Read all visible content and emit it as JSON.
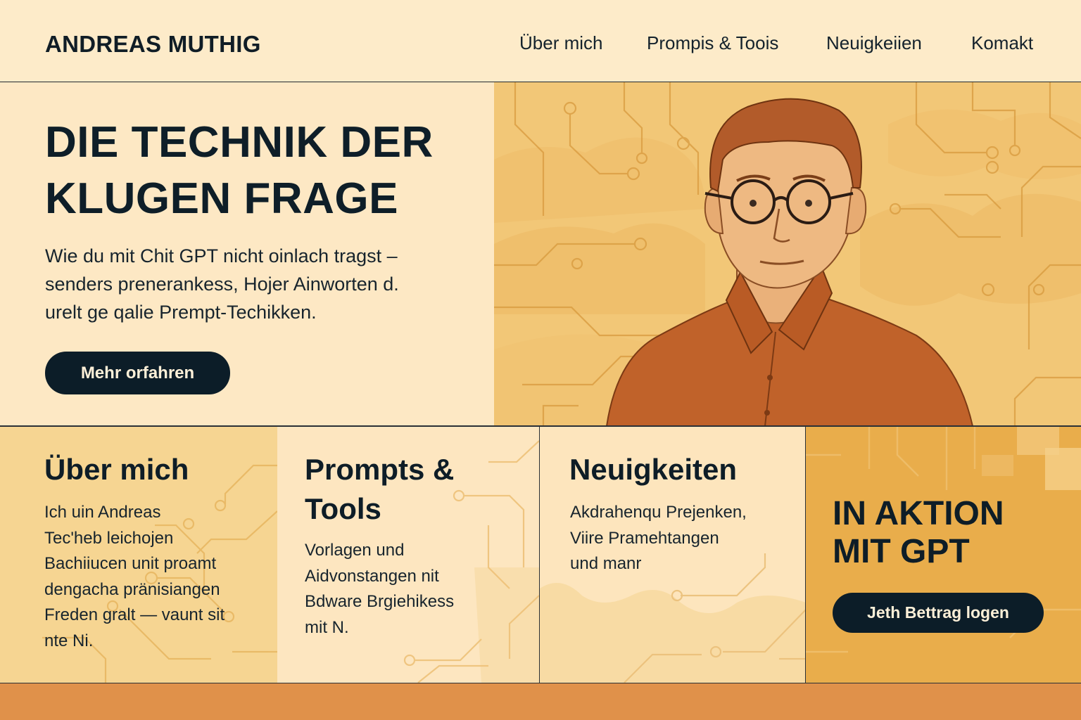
{
  "header": {
    "brand": "ANDREAS MUTHIG",
    "nav": [
      "Über mich",
      "Prompis & Toois",
      "Neuigkeiien",
      "Komakt"
    ]
  },
  "hero": {
    "title": [
      "DIE TECHNIK DER",
      "KLUGEN FRAGE"
    ],
    "subtitle": [
      "Wie du mit Chit GPT nicht oinlach tragst –",
      "senders prenerankess, Hojer Ainworten d.",
      "urelt ge qalie Prempt-Techikken."
    ],
    "button": "Mehr orfahren",
    "portrait": "man-with-glasses-portrait"
  },
  "cards": {
    "about": {
      "title": [
        "Über mich"
      ],
      "text": [
        "Ich uin Andreas",
        "Tec'heb leichojen",
        "Bachiiucen unit proamt",
        "dengacha pränisiangen",
        "Freden gralt — vaunt sit",
        "nte Ni."
      ]
    },
    "prompts": {
      "title": [
        "Prompts &",
        "Tools"
      ],
      "text": [
        "Vorlagen und",
        "Aidvonstangen nit",
        "Bdware Brgiehikess",
        "mit N."
      ]
    },
    "news": {
      "title": [
        "Neuigkeiten"
      ],
      "text": [
        "Akdrahenqu Prejenken,",
        "Viire Pramehtangen",
        "und manr"
      ]
    },
    "action": {
      "title": [
        "IN AKTION",
        "MIT GPT"
      ],
      "button": "Jeth Bettrag logen"
    }
  },
  "colors": {
    "cream": "#fde8c4",
    "mustard": "#f2c777",
    "dark_navy": "#0c1d28",
    "shirt": "#c0622a",
    "footer_band": "#e0914a"
  }
}
